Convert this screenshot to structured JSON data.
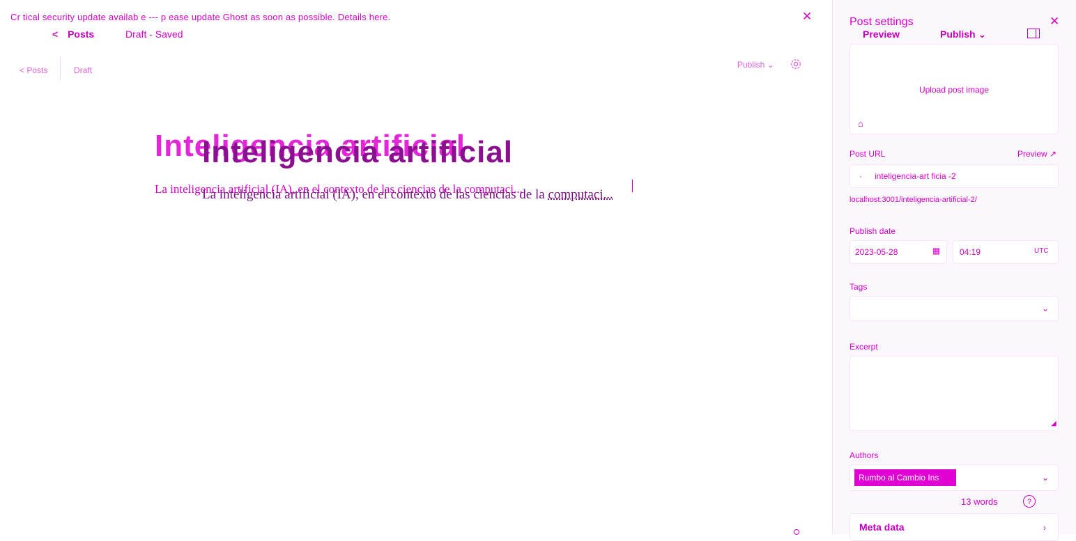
{
  "banner": {
    "text": "Cr tical security update availab e --- p ease update Ghost as soon as possible. Details here.",
    "close_icon": "close-icon"
  },
  "editor_header": {
    "back_label": "Posts",
    "back_glyph": "<",
    "status": "Draft - Saved",
    "ghost_back_label": "< Posts",
    "ghost_status": "Draft",
    "ghost_publish": "Publish",
    "settings_icon": "gear-icon"
  },
  "post": {
    "title": "Inteligencia artificial",
    "excerpt_line": "La inteligencia artificial (IA), en el contexto de las ciencias de la computaci...",
    "body_start": "La inteligencia artificial (IA), en el contexto de las ciencias de la ",
    "body_link": "computaci...",
    "ghost_body": "La inteligencia artificial (IA), en el contexto de las ciencias de la computaci..."
  },
  "sidebar": {
    "title": "Post settings",
    "preview_label": "Preview",
    "publish_label": "Publish",
    "upload_label": "Upload post image",
    "post_url_label": "Post URL",
    "preview_link": "Preview",
    "slug_value": "inteligencia-art ficia -2",
    "url_full": "localhost:3001/inteligencia-artificial-2/",
    "publish_date_label": "Publish date",
    "date_value": "2023-05-28",
    "time_value": "04:19",
    "timezone": "UTC",
    "tags_label": "Tags",
    "excerpt_label": "Excerpt",
    "authors_label": "Authors",
    "author_name": "Rumbo al Cambio Ins",
    "word_count": "13 words",
    "help_glyph": "?",
    "meta_data_label": "Meta data"
  },
  "colors": {
    "accent": "#d400c8",
    "accent_dark": "#8a1090",
    "sidebar_bg": "#fcf7fd"
  }
}
